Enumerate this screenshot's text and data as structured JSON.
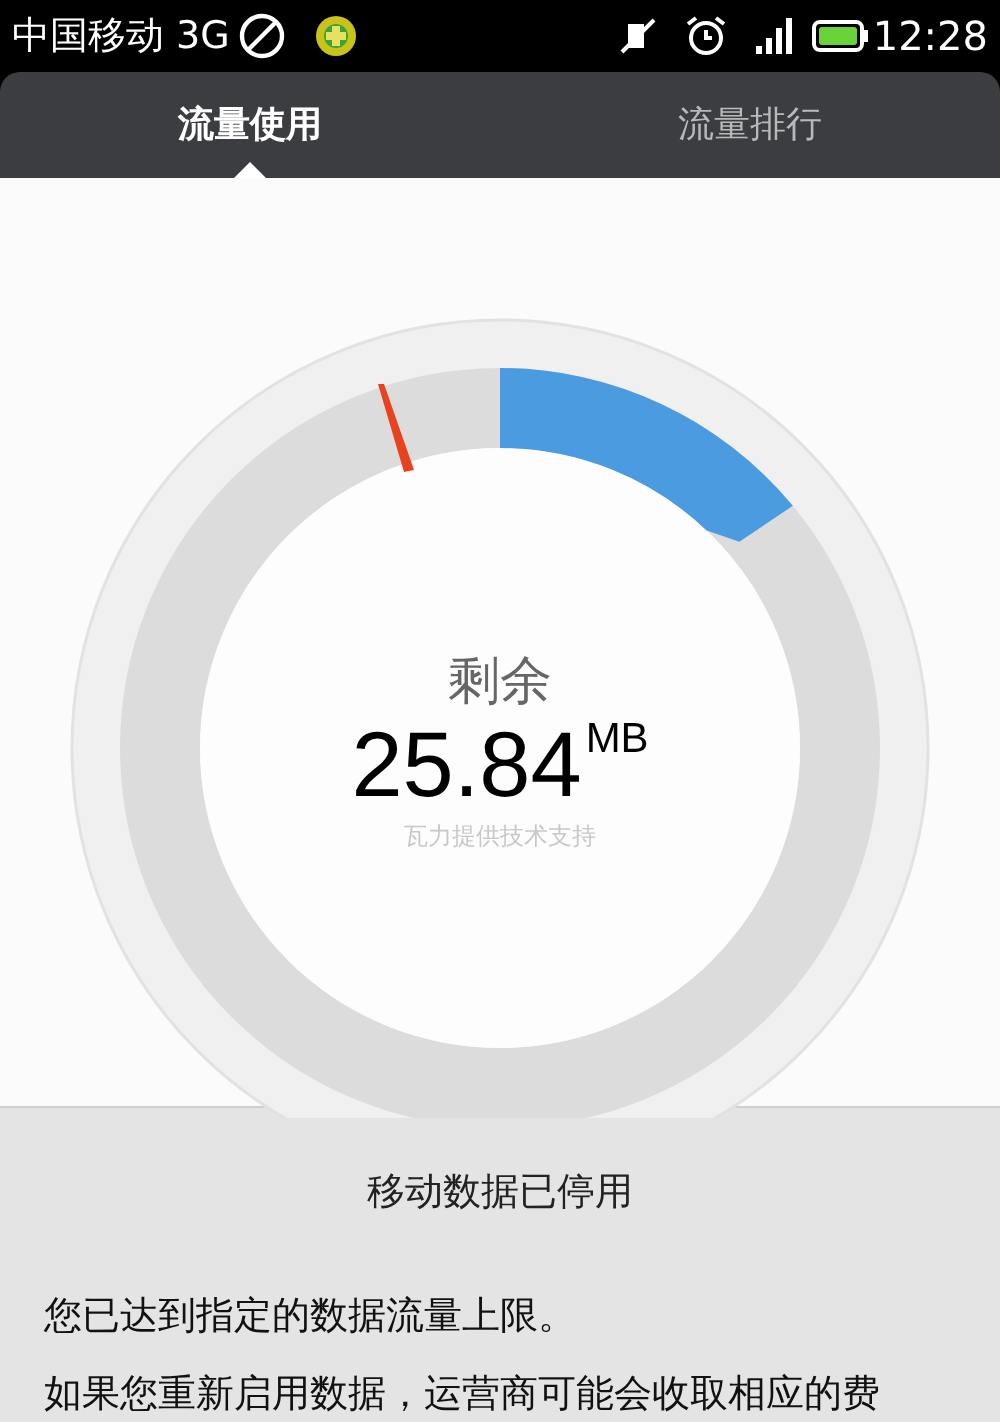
{
  "status_bar": {
    "carrier": "中国移动 3G",
    "time": "12:28"
  },
  "tabs": [
    {
      "label": "流量使用",
      "selected": true
    },
    {
      "label": "流量排行",
      "selected": false
    }
  ],
  "gauge": {
    "label": "剩余",
    "value": "25.84",
    "unit": "MB",
    "credit": "瓦力提供技术支持"
  },
  "dialog": {
    "title": "移动数据已停用",
    "lines": [
      "您已达到指定的数据流量上限。",
      "如果您重新启用数据，运营商可能会收取相应的费"
    ]
  }
}
